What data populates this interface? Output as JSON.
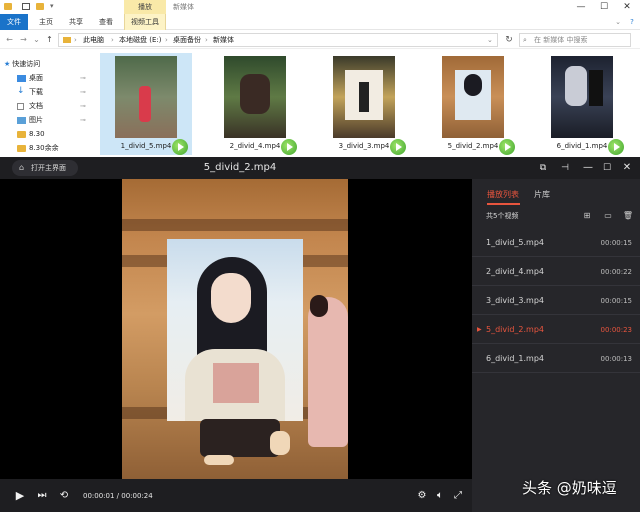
{
  "explorer": {
    "window_title": "新媒体",
    "contextual_tab_group": "播放",
    "ribbon_tabs": [
      "文件",
      "主页",
      "共享",
      "查看",
      "视频工具"
    ],
    "breadcrumbs": [
      "此电脑",
      "本地磁盘 (E:)",
      "桌面备份",
      "新媒体"
    ],
    "search_placeholder": "在 新媒体 中搜索",
    "window_controls": [
      "—",
      "☐",
      "✕"
    ],
    "nav": {
      "quick_access": "快速访问",
      "items": [
        {
          "label": "桌面",
          "icon": "desktop-icon",
          "pinned": true
        },
        {
          "label": "下载",
          "icon": "download-icon",
          "pinned": true
        },
        {
          "label": "文档",
          "icon": "document-icon",
          "pinned": true
        },
        {
          "label": "图片",
          "icon": "picture-icon",
          "pinned": true
        },
        {
          "label": "8.30",
          "icon": "folder-icon",
          "pinned": false
        },
        {
          "label": "8.30余余",
          "icon": "folder-icon",
          "pinned": false
        }
      ]
    },
    "files": [
      {
        "name": "1_divid_5.mp4",
        "selected": true
      },
      {
        "name": "2_divid_4.mp4",
        "selected": false
      },
      {
        "name": "3_divid_3.mp4",
        "selected": false
      },
      {
        "name": "5_divid_2.mp4",
        "selected": false
      },
      {
        "name": "6_divid_1.mp4",
        "selected": false
      }
    ]
  },
  "player": {
    "home_button": "打开主界面",
    "title": "5_divid_2.mp4",
    "current_time": "00:00:01",
    "total_time": "00:00:24",
    "progress_fraction": 0.035,
    "playlist": {
      "tabs": [
        "播放列表",
        "片库"
      ],
      "count_label": "共5个视频",
      "items": [
        {
          "name": "1_divid_5.mp4",
          "duration": "00:00:15",
          "playing": false
        },
        {
          "name": "2_divid_4.mp4",
          "duration": "00:00:22",
          "playing": false
        },
        {
          "name": "3_divid_3.mp4",
          "duration": "00:00:15",
          "playing": false
        },
        {
          "name": "5_divid_2.mp4",
          "duration": "00:00:23",
          "playing": true
        },
        {
          "name": "6_divid_1.mp4",
          "duration": "00:00:13",
          "playing": false
        }
      ]
    }
  },
  "watermark": "头条 @奶味逗",
  "colors": {
    "accent": "#e8553e",
    "progress": "#e23c3c",
    "player_bg": "#1e1e21",
    "selection": "#cde6f7"
  }
}
